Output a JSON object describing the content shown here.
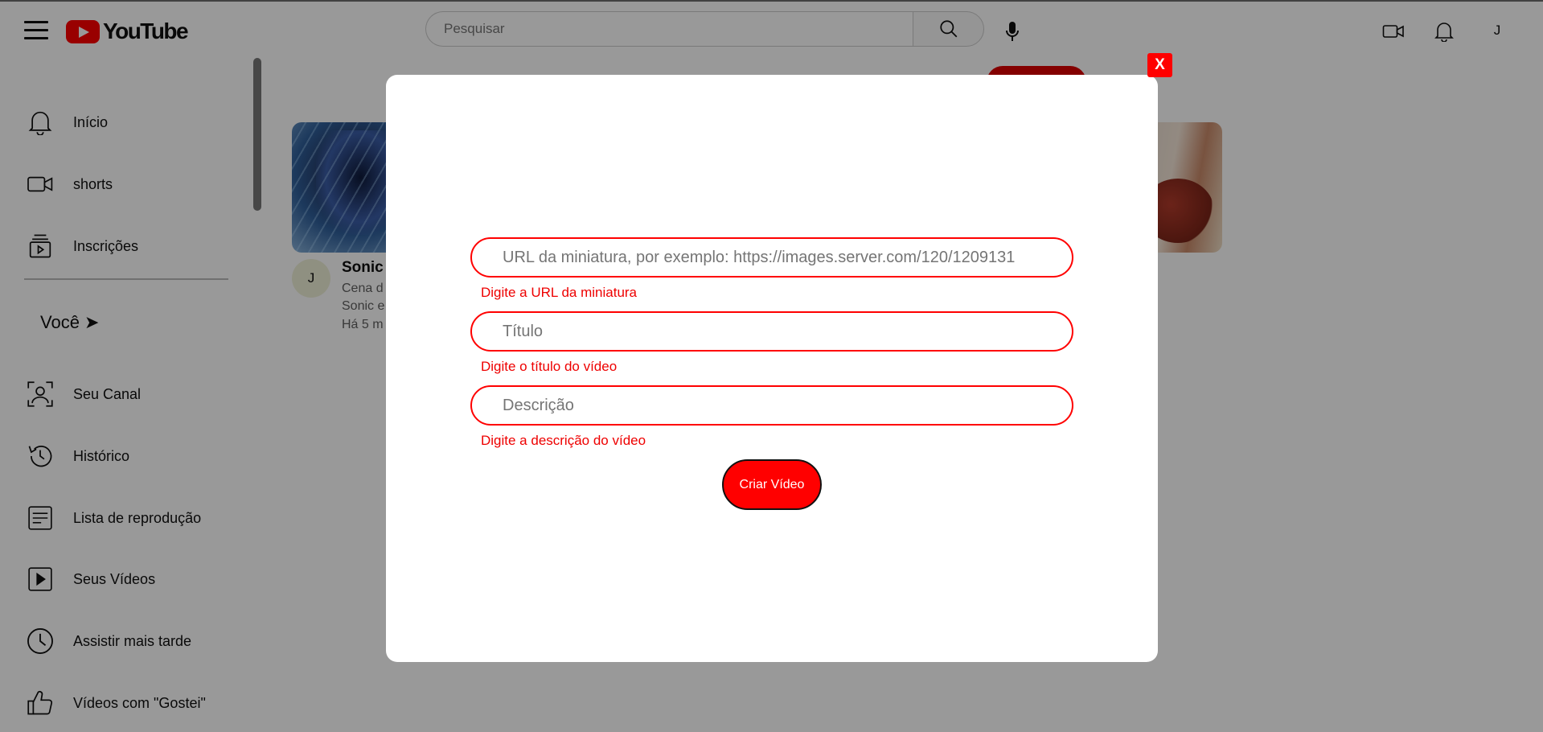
{
  "header": {
    "logo_text": "YouTube",
    "search_placeholder": "Pesquisar",
    "avatar_initial": "J"
  },
  "sidebar": {
    "items": [
      {
        "label": "Início",
        "icon": "bell-icon"
      },
      {
        "label": "shorts",
        "icon": "video-camera-icon"
      },
      {
        "label": "Inscrições",
        "icon": "subscriptions-icon"
      }
    ],
    "section_heading": "Você ➤",
    "you_items": [
      {
        "label": "Seu Canal",
        "icon": "channel-icon"
      },
      {
        "label": "Histórico",
        "icon": "history-icon"
      },
      {
        "label": "Lista de reprodução",
        "icon": "playlist-icon"
      },
      {
        "label": "Seus Vídeos",
        "icon": "play-icon"
      },
      {
        "label": "Assistir mais tarde",
        "icon": "clock-icon"
      },
      {
        "label": "Vídeos com \"Gostei\"",
        "icon": "thumbs-up-icon"
      }
    ]
  },
  "main": {
    "video": {
      "channel_initial": "J",
      "title": "Sonic",
      "meta_lines": [
        "Cena d",
        "Sonic e",
        "Há 5 m"
      ]
    }
  },
  "modal": {
    "close_label": "X",
    "fields": [
      {
        "placeholder": "URL da miniatura, por exemplo: https://images.server.com/120/1209131",
        "error": "Digite a URL da miniatura"
      },
      {
        "placeholder": "Título",
        "error": "Digite o título do vídeo"
      },
      {
        "placeholder": "Descrição",
        "error": "Digite a descrição do vídeo"
      }
    ],
    "submit_label": "Criar Vídeo"
  },
  "colors": {
    "accent": "#ff0000",
    "overlay": "rgba(0,0,0,0.4)",
    "error_text": "#e00000"
  }
}
